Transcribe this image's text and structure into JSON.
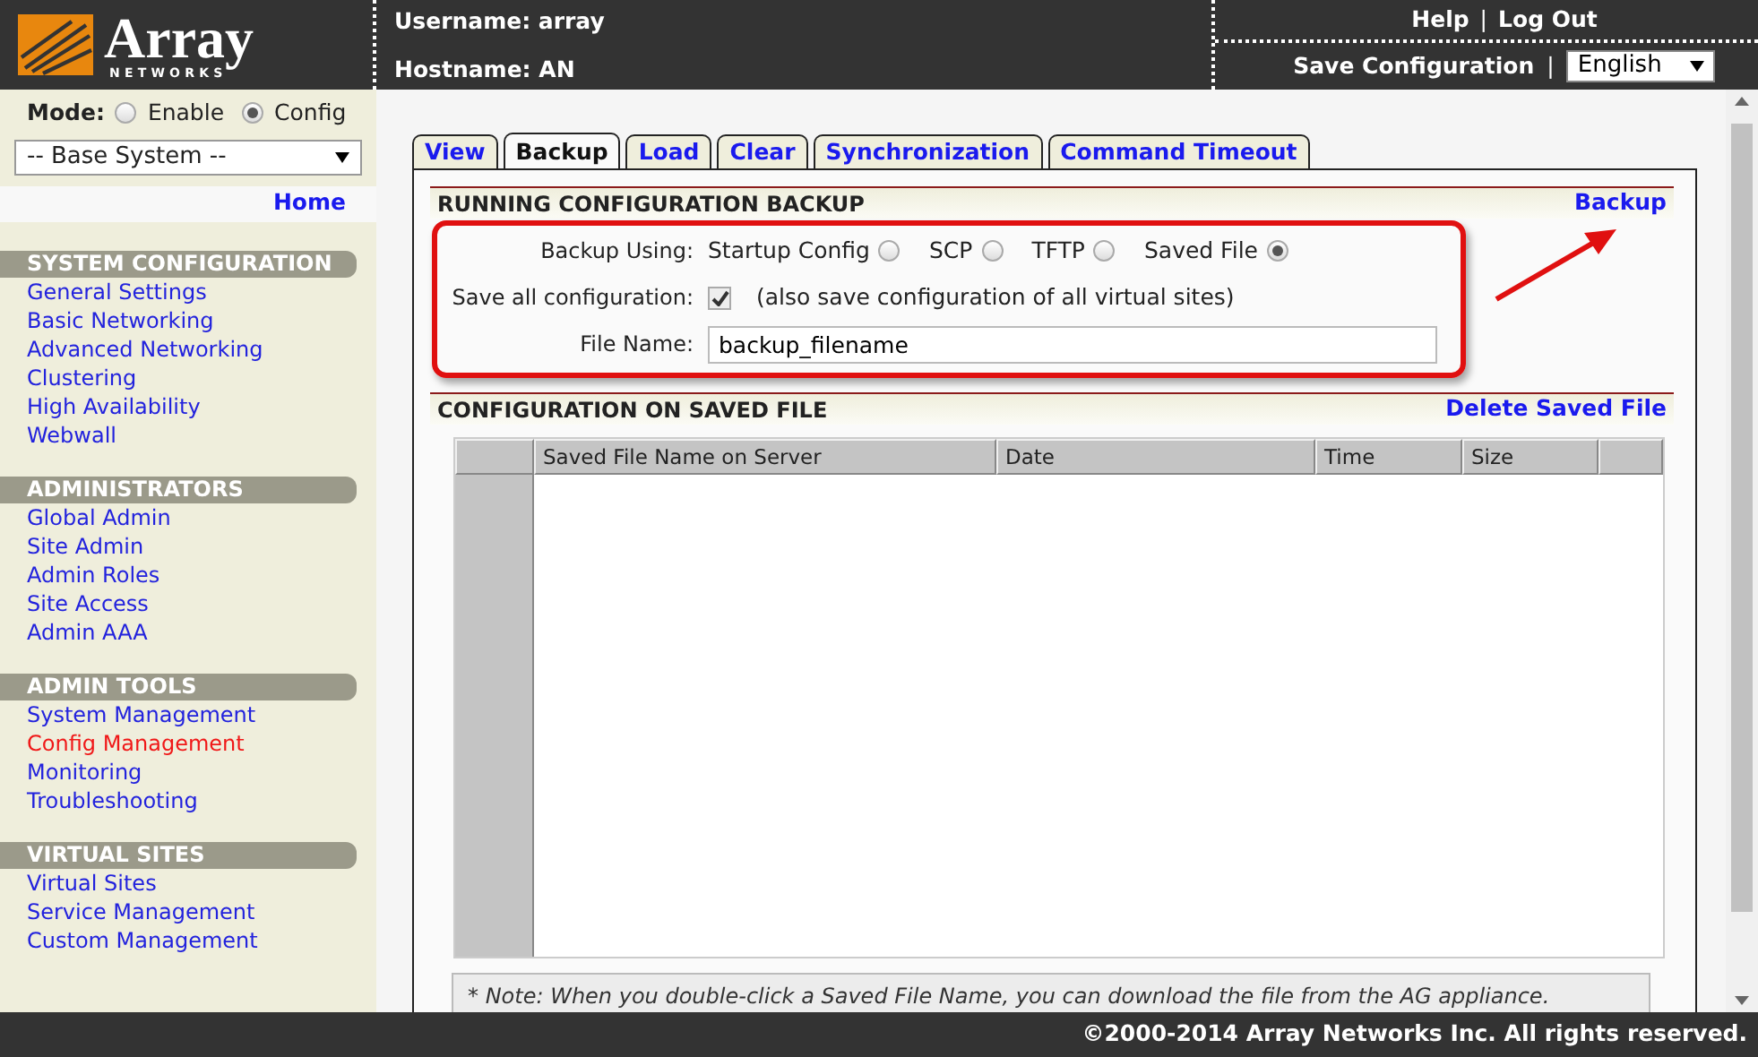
{
  "header": {
    "logo": {
      "name": "Array",
      "sub": "NETWORKS"
    },
    "username": "Username: array",
    "hostname": "Hostname: AN",
    "top_links": [
      {
        "kind": "link",
        "label": "Help"
      },
      {
        "kind": "separator",
        "label": "|"
      },
      {
        "kind": "link",
        "label": "Log Out"
      }
    ],
    "bottom_links": [
      {
        "kind": "link",
        "label": "Save Configuration"
      },
      {
        "kind": "separator",
        "label": "|"
      },
      {
        "kind": "select",
        "label": "English"
      }
    ]
  },
  "sidebar": {
    "mode_label": "Mode:",
    "modes": [
      {
        "label": "Enable",
        "selected": false
      },
      {
        "label": "Config",
        "selected": true
      }
    ],
    "context_select": "-- Base System --",
    "home": "Home",
    "sections": [
      {
        "title": "SYSTEM CONFIGURATION",
        "items": [
          {
            "label": "General Settings",
            "selected": false
          },
          {
            "label": "Basic Networking",
            "selected": false
          },
          {
            "label": "Advanced Networking",
            "selected": false
          },
          {
            "label": "Clustering",
            "selected": false
          },
          {
            "label": "High Availability",
            "selected": false
          },
          {
            "label": "Webwall",
            "selected": false
          }
        ]
      },
      {
        "title": "ADMINISTRATORS",
        "items": [
          {
            "label": "Global Admin",
            "selected": false
          },
          {
            "label": "Site Admin",
            "selected": false
          },
          {
            "label": "Admin Roles",
            "selected": false
          },
          {
            "label": "Site Access",
            "selected": false
          },
          {
            "label": "Admin AAA",
            "selected": false
          }
        ]
      },
      {
        "title": "ADMIN TOOLS",
        "items": [
          {
            "label": "System Management",
            "selected": false
          },
          {
            "label": "Config Management",
            "selected": true
          },
          {
            "label": "Monitoring",
            "selected": false
          },
          {
            "label": "Troubleshooting",
            "selected": false
          }
        ]
      },
      {
        "title": "VIRTUAL SITES",
        "items": [
          {
            "label": "Virtual Sites",
            "selected": false
          },
          {
            "label": "Service Management",
            "selected": false
          },
          {
            "label": "Custom Management",
            "selected": false
          }
        ]
      }
    ]
  },
  "tabs": [
    {
      "label": "View",
      "selected": false
    },
    {
      "label": "Backup",
      "selected": true
    },
    {
      "label": "Load",
      "selected": false
    },
    {
      "label": "Clear",
      "selected": false
    },
    {
      "label": "Synchronization",
      "selected": false
    },
    {
      "label": "Command Timeout",
      "selected": false
    }
  ],
  "backup": {
    "title": "RUNNING CONFIGURATION BACKUP",
    "action": "Backup",
    "backup_using": {
      "label": "Backup Using:",
      "options": [
        {
          "label": "Startup Config",
          "selected": false
        },
        {
          "label": "SCP",
          "selected": false
        },
        {
          "label": "TFTP",
          "selected": false
        },
        {
          "label": "Saved File",
          "selected": true
        }
      ]
    },
    "save_all": {
      "label": "Save all configuration:",
      "checked": true,
      "hint": "(also save configuration of all virtual sites)"
    },
    "file_name": {
      "label": "File Name:",
      "value": "backup_filename"
    }
  },
  "saved": {
    "title": "CONFIGURATION ON SAVED FILE",
    "action": "Delete Saved File",
    "columns": [
      "Saved File Name on Server",
      "Date",
      "Time",
      "Size"
    ],
    "note": "* Note: When you double-click a Saved File Name, you can download the file from the AG appliance."
  },
  "footer": "©2000-2014 Array Networks Inc. All rights reserved."
}
